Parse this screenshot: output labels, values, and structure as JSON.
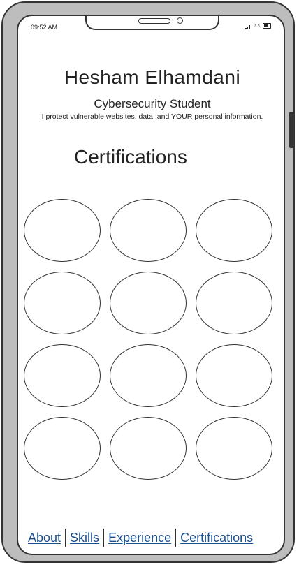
{
  "status_bar": {
    "time": "09:52 AM"
  },
  "profile": {
    "name": "Hesham Elhamdani",
    "subtitle": "Cybersecurity Student",
    "tagline": "I protect vulnerable websites, data, and YOUR personal information."
  },
  "section": {
    "title": "Certifications"
  },
  "certifications": {
    "rows": 4,
    "columns": 3
  },
  "nav": {
    "items": [
      {
        "label": "About"
      },
      {
        "label": "Skills"
      },
      {
        "label": "Experience"
      },
      {
        "label": "Certifications"
      }
    ]
  },
  "colors": {
    "link": "#1a4f8f",
    "frame": "#bdbdbd",
    "stroke": "#333333"
  }
}
